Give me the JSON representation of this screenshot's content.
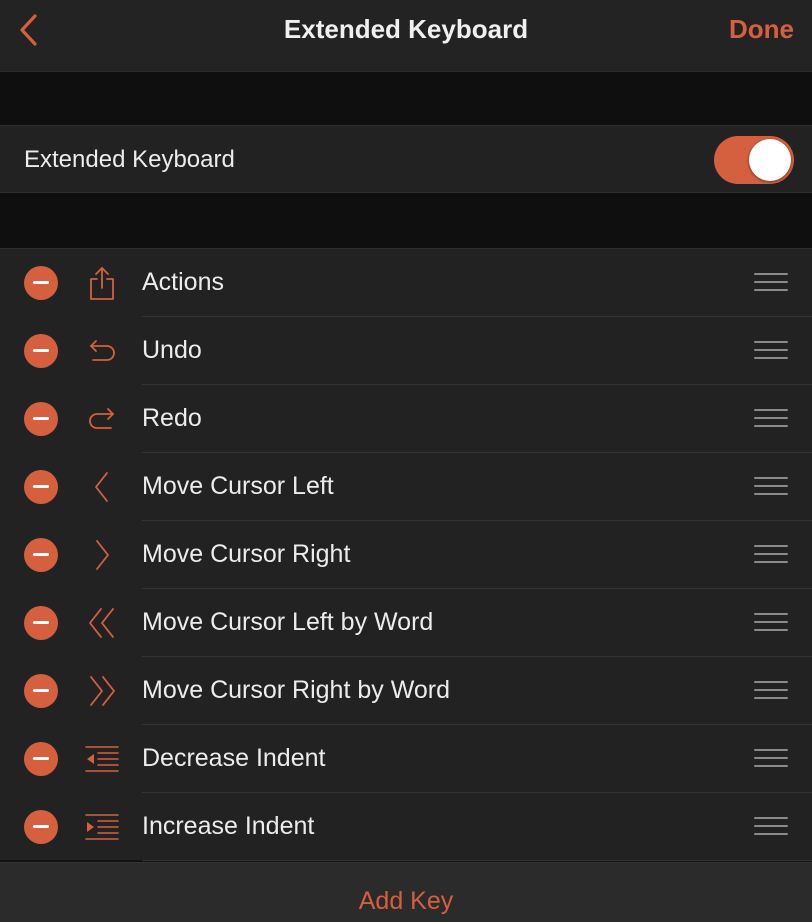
{
  "nav": {
    "title": "Extended Keyboard",
    "done_label": "Done",
    "back_icon": "chevron-left-icon"
  },
  "settings": {
    "extended_keyboard_label": "Extended Keyboard",
    "extended_keyboard_enabled": true
  },
  "keys": [
    {
      "label": "Actions",
      "icon": "share-icon"
    },
    {
      "label": "Undo",
      "icon": "undo-icon"
    },
    {
      "label": "Redo",
      "icon": "redo-icon"
    },
    {
      "label": "Move Cursor Left",
      "icon": "chevron-left-icon"
    },
    {
      "label": "Move Cursor Right",
      "icon": "chevron-right-icon"
    },
    {
      "label": "Move Cursor Left by Word",
      "icon": "double-chevron-left-icon"
    },
    {
      "label": "Move Cursor Right by Word",
      "icon": "double-chevron-right-icon"
    },
    {
      "label": "Decrease Indent",
      "icon": "decrease-indent-icon"
    },
    {
      "label": "Increase Indent",
      "icon": "increase-indent-icon"
    }
  ],
  "footer": {
    "add_key_label": "Add Key"
  },
  "colors": {
    "accent": "#d5603f",
    "background": "#121212",
    "row_background": "#222222"
  }
}
